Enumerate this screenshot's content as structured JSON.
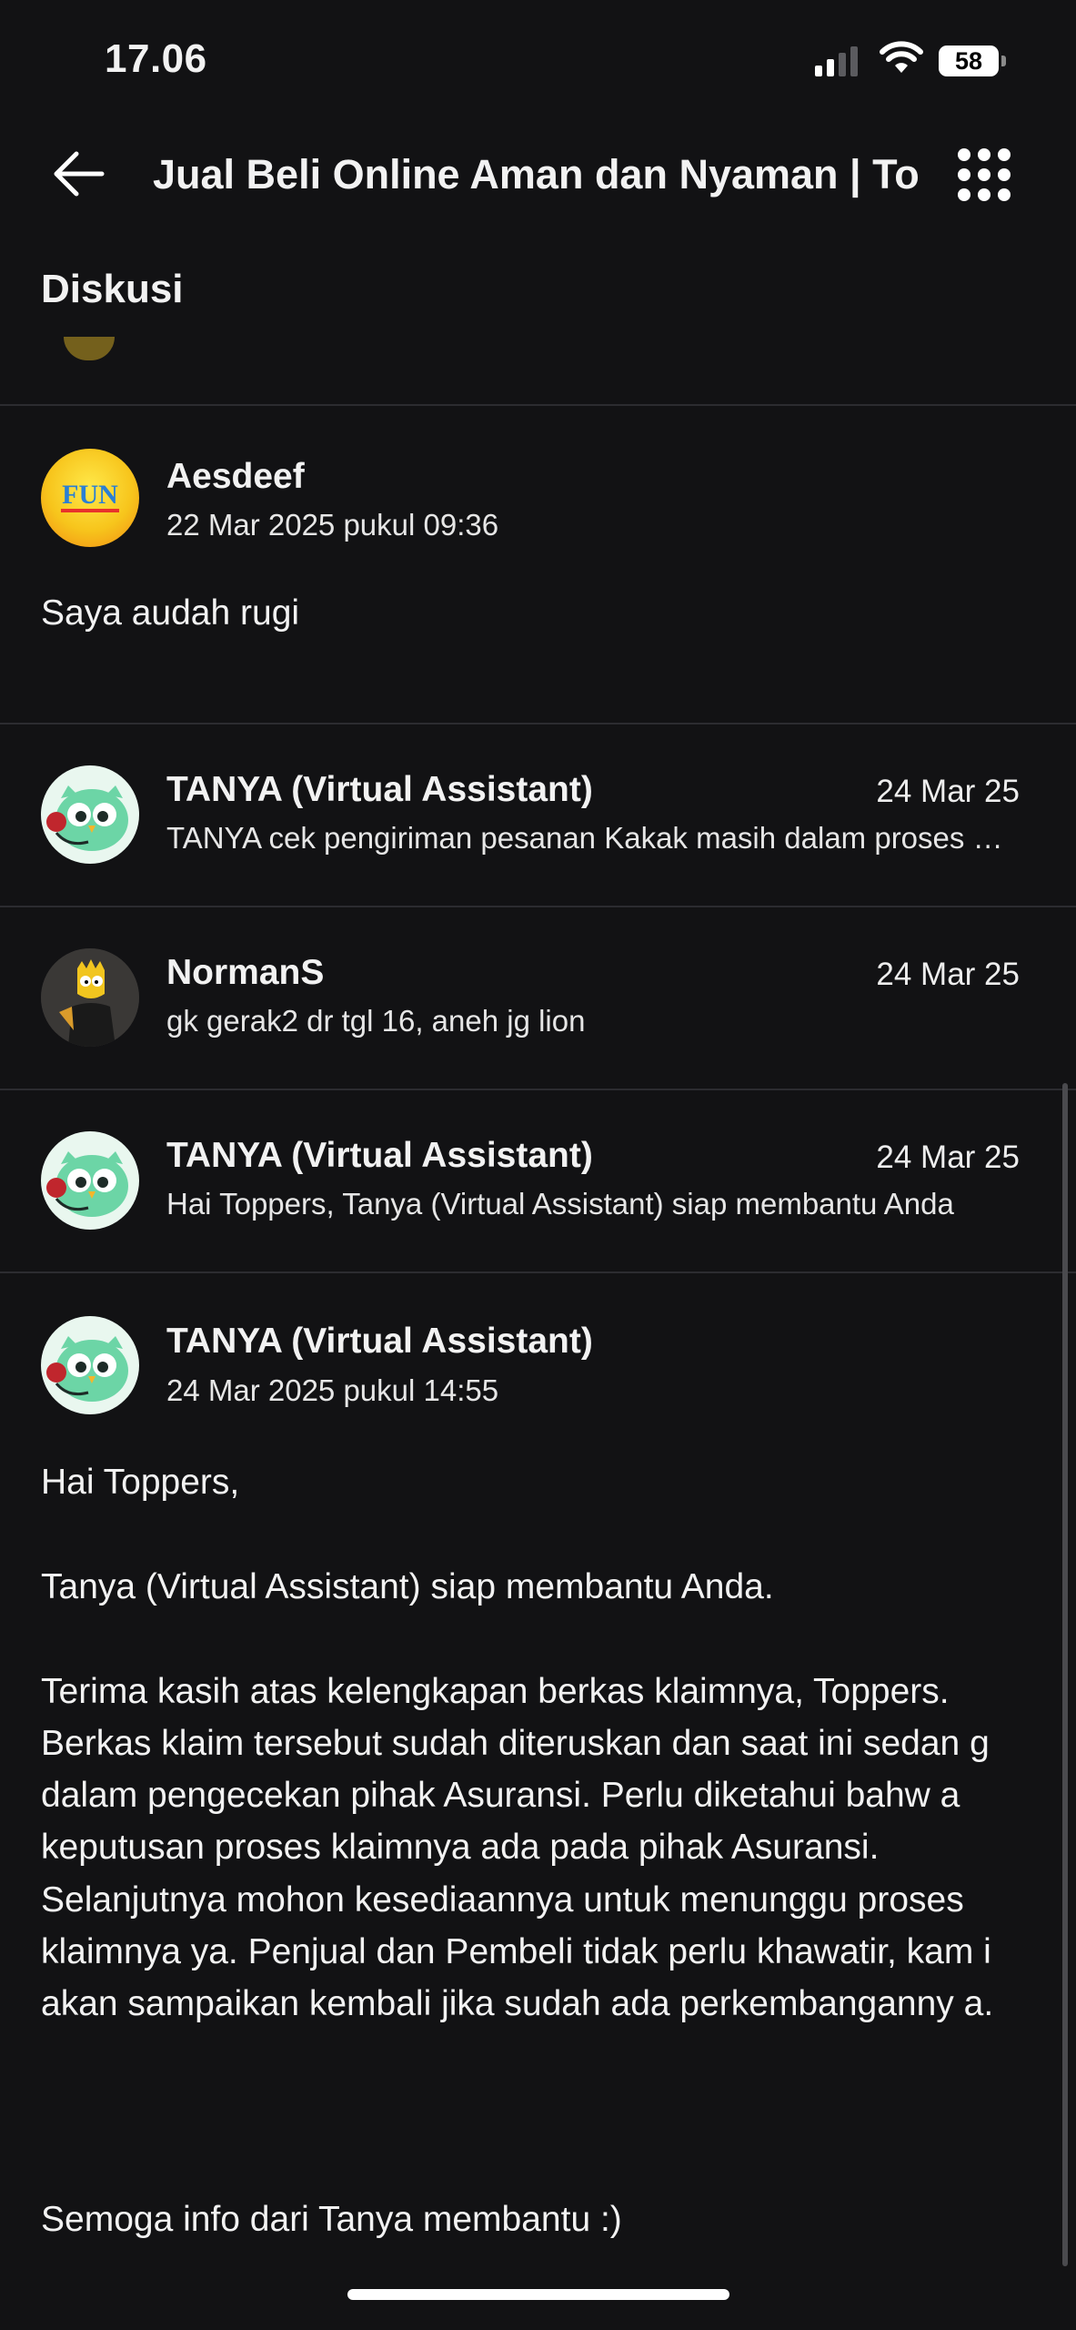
{
  "status_bar": {
    "time": "17.06",
    "battery": "58"
  },
  "header": {
    "title": "Jual Beli Online Aman dan Nyaman | To"
  },
  "section": {
    "title": "Diskusi"
  },
  "comment_main": {
    "author": "Aesdeef",
    "timestamp": "22 Mar 2025 pukul 09:36",
    "text": "Saya audah rugi",
    "avatar_text": "FUN"
  },
  "replies": [
    {
      "author": "TANYA (Virtual Assistant)",
      "date": "24 Mar 25",
      "preview": "TANYA cek pengiriman pesanan Kakak masih dalam proses pengiriman"
    },
    {
      "author": "NormanS",
      "date": "24 Mar 25",
      "preview": "gk gerak2 dr tgl 16, aneh jg lion"
    },
    {
      "author": "TANYA (Virtual Assistant)",
      "date": "24 Mar 25",
      "preview": "Hai Toppers, Tanya (Virtual Assistant) siap membantu Anda"
    }
  ],
  "expanded_reply": {
    "author": "TANYA (Virtual Assistant)",
    "timestamp": "24 Mar 2025 pukul 14:55",
    "paragraphs": [
      "Hai Toppers,",
      "Tanya (Virtual Assistant) siap membantu Anda.",
      "Terima kasih atas kelengkapan berkas klaimnya, Toppers. Berkas klaim tersebut sudah diteruskan dan saat ini sedan g dalam pengecekan pihak Asuransi. Perlu diketahui bahw a keputusan proses klaimnya ada pada pihak Asuransi.",
      "Selanjutnya mohon kesediaannya untuk menunggu proses klaimnya ya. Penjual dan Pembeli tidak perlu khawatir, kam i akan sampaikan kembali jika sudah ada perkembanganny a.",
      "Semoga info dari Tanya membantu :)"
    ]
  },
  "colors": {
    "background": "#121214",
    "divider": "#2c2c30",
    "owl_green": "#6cd5a6",
    "owl_headset": "#c0262d"
  }
}
